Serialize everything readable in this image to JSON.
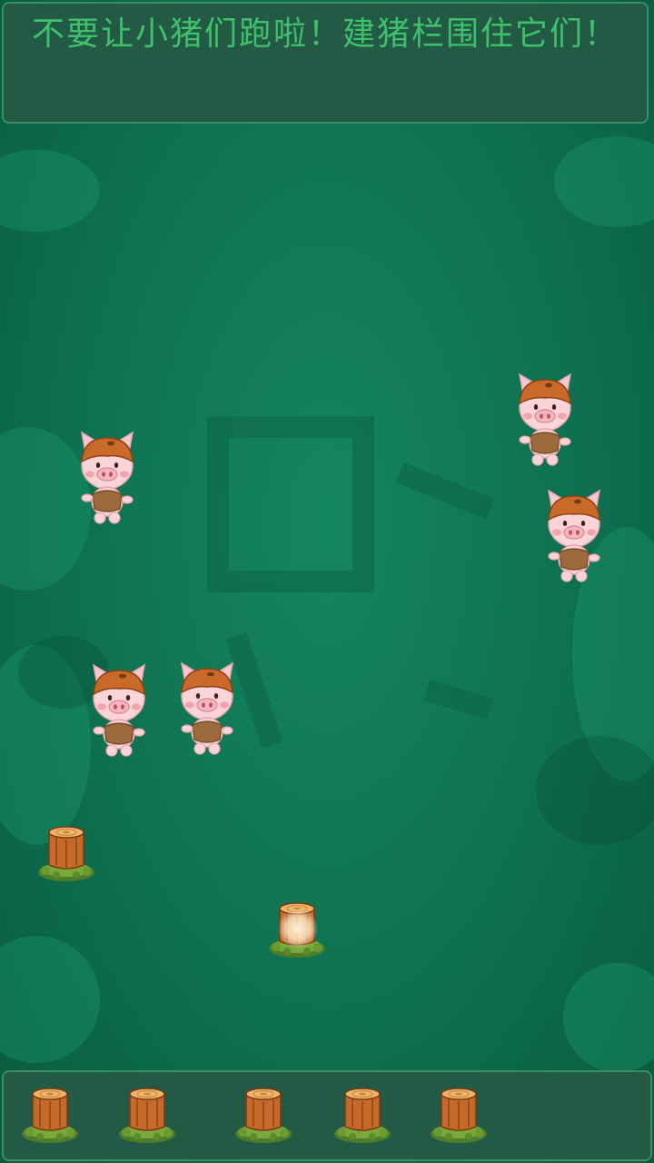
{
  "header": {
    "instruction": "不要让小猪们跑啦！建猪栏围住它们！"
  },
  "board": {
    "pigs_count": 5,
    "placed_stumps_count": 2,
    "pig_icon": "pig-icon",
    "stump_icon": "tree-stump-icon",
    "cursor_icon": "glow-cursor-icon"
  },
  "toolbar": {
    "fence_slots": 5,
    "slot_icon": "tree-stump-icon"
  },
  "colors": {
    "background": "#0f6b4f",
    "panel": "#235a45",
    "panel_border": "#3a8f66",
    "instruction_text": "#3ec16a"
  }
}
